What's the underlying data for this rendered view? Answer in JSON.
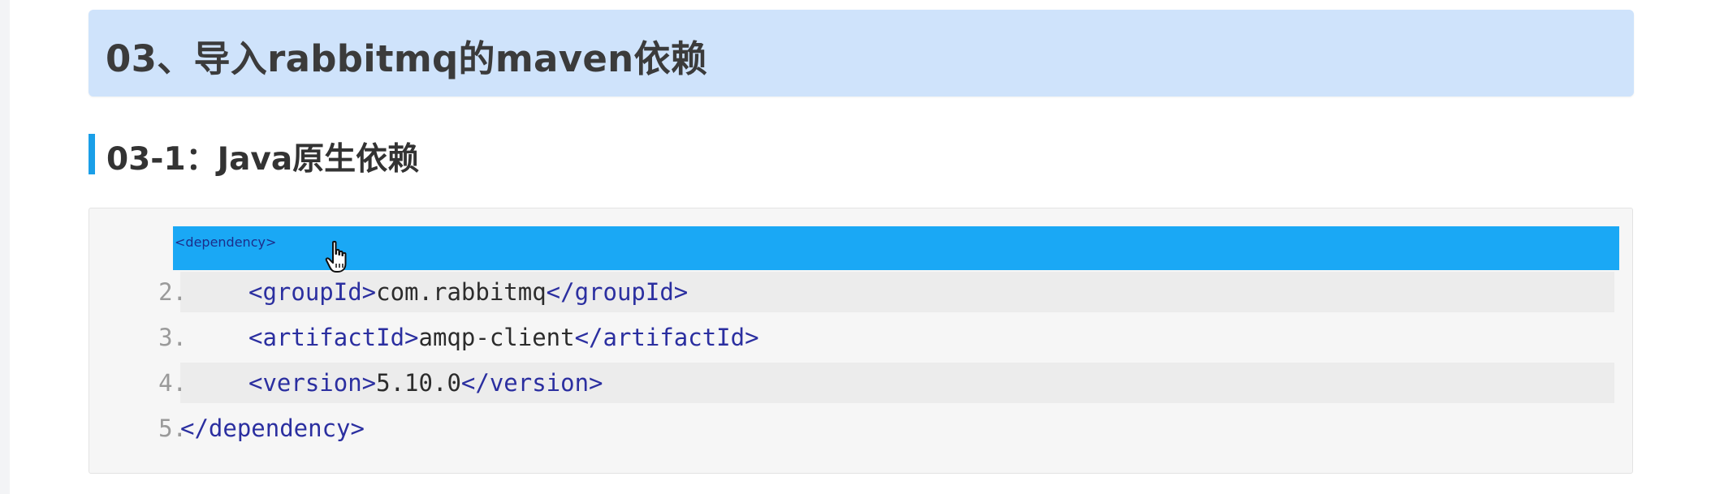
{
  "heading": {
    "title": "03、导入rabbitmq的maven依赖"
  },
  "subheading": {
    "title": "03-1：Java原生依赖"
  },
  "code_block": {
    "language": "xml",
    "lines": [
      {
        "number": "",
        "open_tag": "<dependency>",
        "content": "",
        "close_tag": "",
        "selected": true
      },
      {
        "number": "2.",
        "open_tag": "<groupId>",
        "content": "com.rabbitmq",
        "close_tag": "</groupId>",
        "selected": false
      },
      {
        "number": "3.",
        "open_tag": "<artifactId>",
        "content": "amqp-client",
        "close_tag": "</artifactId>",
        "selected": false
      },
      {
        "number": "4.",
        "open_tag": "<version>",
        "content": "5.10.0",
        "close_tag": "</version>",
        "selected": false
      },
      {
        "number": "5.",
        "open_tag": "</dependency>",
        "content": "",
        "close_tag": "",
        "selected": false
      }
    ]
  },
  "colors": {
    "heading_bg": "#cfe3fb",
    "accent": "#1a9fe8",
    "selection": "#1aa8f5",
    "tag": "#2b2fa0"
  },
  "icons": {
    "cursor": "hand-pointer-icon"
  }
}
